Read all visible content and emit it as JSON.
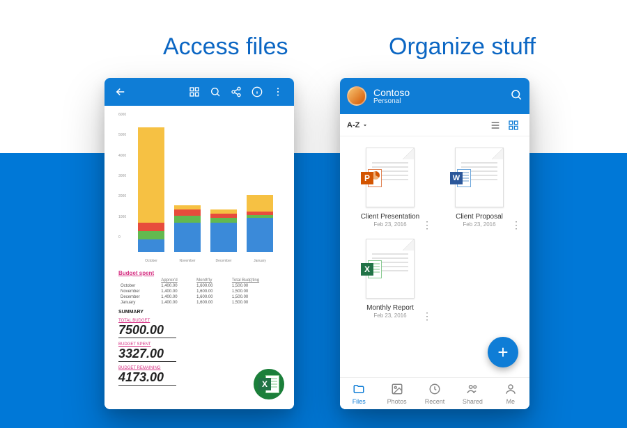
{
  "captions": {
    "left": "Access files",
    "right": "Organize stuff"
  },
  "colors": {
    "brand": "#0f7dd6",
    "chart": {
      "blue": "#3b8ad9",
      "green": "#63b94f",
      "red": "#e74c3c",
      "yellow": "#f6c143"
    }
  },
  "phone1": {
    "table": {
      "caption": "Budget spent",
      "headers": [
        "",
        "Approx'd",
        "Month'ly",
        "Total Budg'ting"
      ],
      "rows": [
        [
          "October",
          "1,400.00",
          "1,600.00",
          "1,500.00"
        ],
        [
          "November",
          "1,400.00",
          "1,600.00",
          "1,500.00"
        ],
        [
          "December",
          "1,400.00",
          "1,600.00",
          "1,500.00"
        ],
        [
          "January",
          "1,400.00",
          "1,600.00",
          "1,500.00"
        ]
      ]
    },
    "summary": {
      "title": "SUMMARY",
      "items": [
        {
          "label": "TOTAL BUDGET",
          "value": "7500.00"
        },
        {
          "label": "BUDGET SPENT",
          "value": "3327.00"
        },
        {
          "label": "BUDGET REMAINING",
          "value": "4173.00"
        }
      ]
    }
  },
  "phone2": {
    "account": {
      "name": "Contoso",
      "type": "Personal"
    },
    "sort": "A-Z",
    "files": [
      {
        "name": "Client Presentation",
        "date": "Feb 23, 2016",
        "app": "powerpoint"
      },
      {
        "name": "Client Proposal",
        "date": "Feb 23, 2016",
        "app": "word"
      },
      {
        "name": "Monthly Report",
        "date": "Feb 23, 2016",
        "app": "excel"
      }
    ],
    "nav": [
      {
        "label": "Files",
        "icon": "folder",
        "active": true
      },
      {
        "label": "Photos",
        "icon": "photo"
      },
      {
        "label": "Recent",
        "icon": "clock"
      },
      {
        "label": "Shared",
        "icon": "people"
      },
      {
        "label": "Me",
        "icon": "person"
      }
    ]
  },
  "chart_data": {
    "type": "bar",
    "stacked": true,
    "categories": [
      "October",
      "November",
      "December",
      "January"
    ],
    "series": [
      {
        "name": "Blue",
        "color": "#3b8ad9",
        "values": [
          600,
          1400,
          1400,
          1600
        ]
      },
      {
        "name": "Green",
        "color": "#63b94f",
        "values": [
          400,
          300,
          200,
          150
        ]
      },
      {
        "name": "Red",
        "color": "#e74c3c",
        "values": [
          400,
          300,
          200,
          150
        ]
      },
      {
        "name": "Yellow",
        "color": "#f6c143",
        "values": [
          4500,
          200,
          200,
          800
        ]
      }
    ],
    "ylim": [
      0,
      6000
    ],
    "yticks": [
      0,
      1000,
      2000,
      3000,
      4000,
      5000,
      6000
    ],
    "xlabel": "",
    "ylabel": "",
    "title": ""
  }
}
